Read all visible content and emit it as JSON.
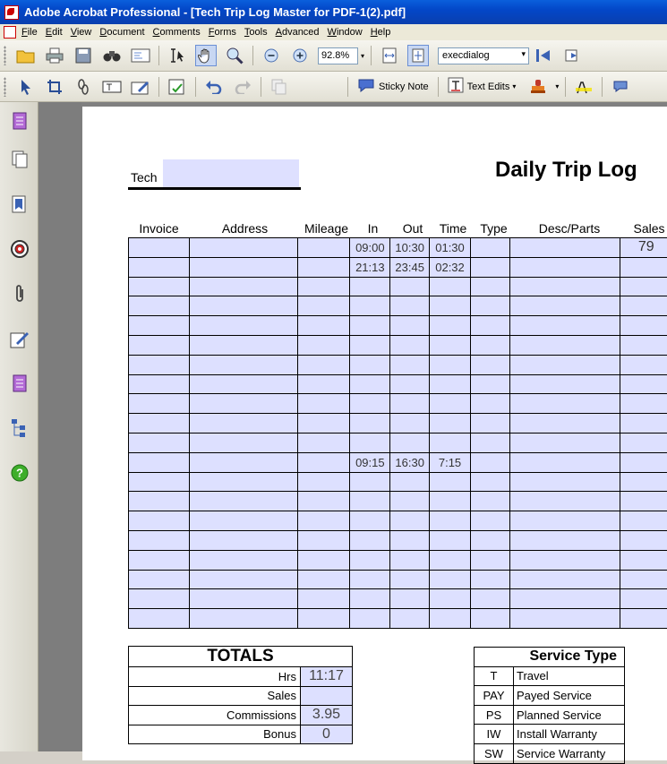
{
  "window": {
    "title": "Adobe Acrobat Professional - [Tech Trip Log Master for PDF-1(2).pdf]"
  },
  "menu": [
    "File",
    "Edit",
    "View",
    "Document",
    "Comments",
    "Forms",
    "Tools",
    "Advanced",
    "Window",
    "Help"
  ],
  "toolbar": {
    "zoom": "92.8%",
    "find_value": "execdialog",
    "sticky_note": "Sticky Note",
    "text_edits": "Text Edits"
  },
  "form": {
    "tech_label": "Tech",
    "tech_value": "",
    "title": "Daily Trip Log",
    "columns": [
      "Invoice",
      "Address",
      "Mileage",
      "In",
      "Out",
      "Time",
      "Type",
      "Desc/Parts",
      "Sales"
    ],
    "rows": [
      [
        "",
        "",
        "",
        "09:00",
        "10:30",
        "01:30",
        "",
        "",
        "79"
      ],
      [
        "",
        "",
        "",
        "21:13",
        "23:45",
        "02:32",
        "",
        "",
        ""
      ],
      [
        "",
        "",
        "",
        "",
        "",
        "",
        "",
        "",
        ""
      ],
      [
        "",
        "",
        "",
        "",
        "",
        "",
        "",
        "",
        ""
      ],
      [
        "",
        "",
        "",
        "",
        "",
        "",
        "",
        "",
        ""
      ],
      [
        "",
        "",
        "",
        "",
        "",
        "",
        "",
        "",
        ""
      ],
      [
        "",
        "",
        "",
        "",
        "",
        "",
        "",
        "",
        ""
      ],
      [
        "",
        "",
        "",
        "",
        "",
        "",
        "",
        "",
        ""
      ],
      [
        "",
        "",
        "",
        "",
        "",
        "",
        "",
        "",
        ""
      ],
      [
        "",
        "",
        "",
        "",
        "",
        "",
        "",
        "",
        ""
      ],
      [
        "",
        "",
        "",
        "",
        "",
        "",
        "",
        "",
        ""
      ],
      [
        "",
        "",
        "",
        "09:15",
        "16:30",
        "7:15",
        "",
        "",
        ""
      ],
      [
        "",
        "",
        "",
        "",
        "",
        "",
        "",
        "",
        ""
      ],
      [
        "",
        "",
        "",
        "",
        "",
        "",
        "",
        "",
        ""
      ],
      [
        "",
        "",
        "",
        "",
        "",
        "",
        "",
        "",
        ""
      ],
      [
        "",
        "",
        "",
        "",
        "",
        "",
        "",
        "",
        ""
      ],
      [
        "",
        "",
        "",
        "",
        "",
        "",
        "",
        "",
        ""
      ],
      [
        "",
        "",
        "",
        "",
        "",
        "",
        "",
        "",
        ""
      ],
      [
        "",
        "",
        "",
        "",
        "",
        "",
        "",
        "",
        ""
      ],
      [
        "",
        "",
        "",
        "",
        "",
        "",
        "",
        "",
        ""
      ]
    ],
    "totals": {
      "title": "TOTALS",
      "items": [
        {
          "label": "Hrs",
          "value": "11:17"
        },
        {
          "label": "Sales",
          "value": ""
        },
        {
          "label": "Commissions",
          "value": "3.95"
        },
        {
          "label": "Bonus",
          "value": "0"
        }
      ]
    },
    "service_type": {
      "title": "Service Type",
      "items": [
        {
          "code": "T",
          "name": "Travel"
        },
        {
          "code": "PAY",
          "name": "Payed Service"
        },
        {
          "code": "PS",
          "name": "Planned Service"
        },
        {
          "code": "IW",
          "name": "Install Warranty"
        },
        {
          "code": "SW",
          "name": "Service Warranty"
        }
      ]
    }
  }
}
